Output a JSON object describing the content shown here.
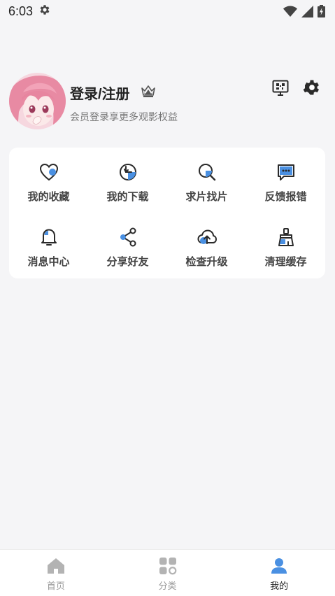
{
  "status_bar": {
    "time": "6:03",
    "icons": [
      "settings-gear-icon",
      "wifi-icon",
      "cellular-signal-icon",
      "battery-charging-icon"
    ]
  },
  "profile": {
    "avatar_icon": "anime-avatar",
    "login_label": "登录/注册",
    "vip_icon": "crown-icon",
    "subtitle": "会员登录享更多观影权益",
    "qr_icon": "screen-qr-icon",
    "settings_icon": "gear-icon"
  },
  "features": [
    {
      "label": "我的收藏",
      "icon": "heart-icon"
    },
    {
      "label": "我的下载",
      "icon": "download-icon"
    },
    {
      "label": "求片找片",
      "icon": "search-icon"
    },
    {
      "label": "反馈报错",
      "icon": "feedback-icon"
    },
    {
      "label": "消息中心",
      "icon": "bell-icon"
    },
    {
      "label": "分享好友",
      "icon": "share-icon"
    },
    {
      "label": "检查升级",
      "icon": "cloud-upload-icon"
    },
    {
      "label": "清理缓存",
      "icon": "broom-icon"
    }
  ],
  "bottom_nav": [
    {
      "label": "首页",
      "icon": "home-icon",
      "active": false
    },
    {
      "label": "分类",
      "icon": "category-icon",
      "active": false
    },
    {
      "label": "我的",
      "icon": "user-icon",
      "active": true
    }
  ],
  "colors": {
    "accent": "#4a90e2",
    "icon_dark": "#2a2a2a",
    "background": "#f5f5f7"
  }
}
